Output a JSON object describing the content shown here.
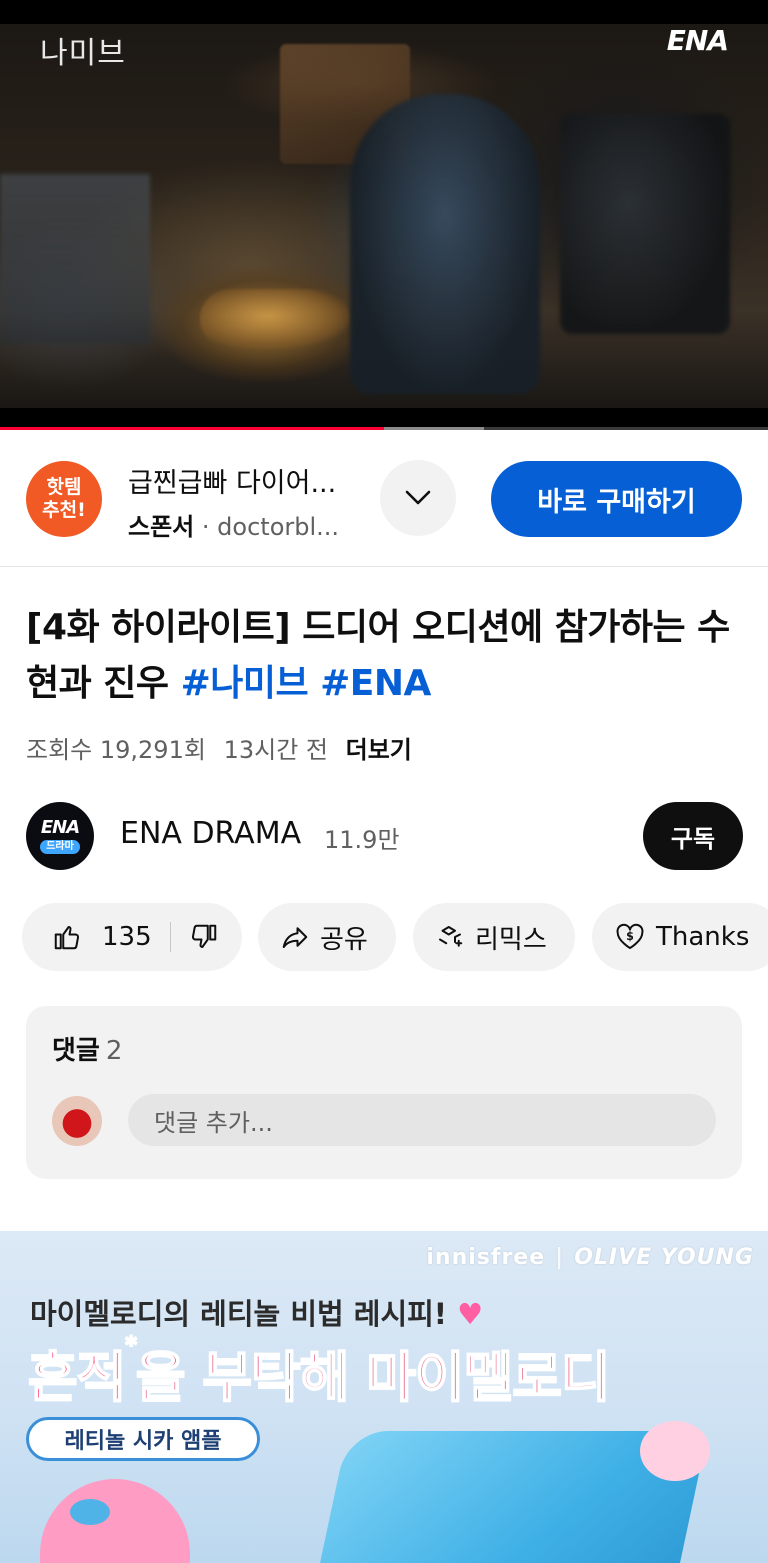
{
  "player": {
    "watermark_title": "나미브",
    "watermark_logo": "ENA",
    "progress_fraction": 0.5,
    "buffer_fraction": 0.63
  },
  "ad": {
    "logo_line1": "핫템",
    "logo_line2": "추천!",
    "title": "급찐급빠 다이어...",
    "sponsor_label": "스폰서",
    "separator": "·",
    "advertiser": "doctorbl...",
    "cta": "바로 구매하기"
  },
  "video": {
    "title_main": "[4화 하이라이트] 드디어 오디션에 참가하는 수현과 진우",
    "tag1": "#나미브",
    "tag2": "#ENA",
    "views": "조회수 19,291회",
    "time": "13시간 전",
    "more": "더보기"
  },
  "channel": {
    "avatar_logo": "ENA",
    "avatar_sub": "드라마",
    "name": "ENA DRAMA",
    "subscribers": "11.9만",
    "subscribe_label": "구독"
  },
  "actions": {
    "like_count": "135",
    "share": "공유",
    "remix": "리믹스",
    "thanks": "Thanks"
  },
  "comments": {
    "label": "댓글",
    "count": "2",
    "placeholder": "댓글 추가..."
  },
  "promo": {
    "brand1": "innisfree",
    "brand2": "OLIVE YOUNG",
    "line1": "마이멜로디의 레티놀 비법 레시피!",
    "heart": "♥",
    "line2_emph": "흔적",
    "line2_star": "*",
    "line2_rest": "을 부탁해 마이멜로디",
    "pill": "레티놀 시카 앰플"
  },
  "colors": {
    "accent_blue": "#065fd4",
    "progress_red": "#ff0033",
    "ad_orange": "#f15a24"
  }
}
